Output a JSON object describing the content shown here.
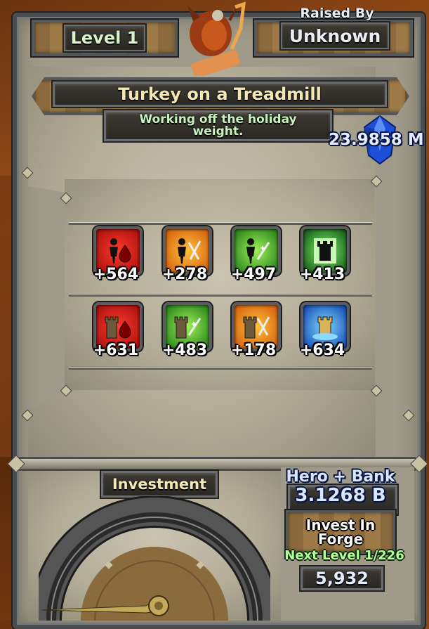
{
  "hero": {
    "level_label": "Level 1",
    "raised_by_label": "Raised By",
    "raised_by_value": "Unknown",
    "name": "Turkey on a Treadmill",
    "description": "Working off the holiday weight.",
    "gem_value": "23.9858 M"
  },
  "stats": [
    {
      "value": "+564",
      "icon": "hero-blood-icon",
      "color": "red"
    },
    {
      "value": "+278",
      "icon": "hero-sword-icon",
      "color": "orange"
    },
    {
      "value": "+497",
      "icon": "hero-heal-sword-icon",
      "color": "green"
    },
    {
      "value": "+413",
      "icon": "tower-icon",
      "color": "green"
    },
    {
      "value": "+631",
      "icon": "tower-blood-icon",
      "color": "red"
    },
    {
      "value": "+483",
      "icon": "tower-heal-sword-icon",
      "color": "green"
    },
    {
      "value": "+178",
      "icon": "tower-sword-icon",
      "color": "orange"
    },
    {
      "value": "+634",
      "icon": "tower-water-icon",
      "color": "blue"
    }
  ],
  "investment": {
    "label": "Investment"
  },
  "bank": {
    "label": "Hero + Bank",
    "value": "3.1268 B",
    "invest_label_1": "Invest In",
    "invest_label_2": "Forge",
    "next_level_label": "Next Level 1/226",
    "cost": "5,932"
  },
  "colors": {
    "red": "#c41414",
    "orange": "#e07a10",
    "green": "#1f8e1c",
    "blue": "#1f5ad6",
    "gold_text": "#f3e7b3",
    "mint_text": "#c8f3c0"
  }
}
